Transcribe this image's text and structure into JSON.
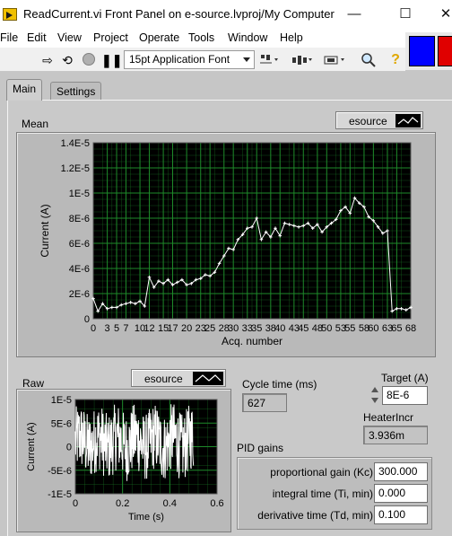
{
  "window": {
    "title": "ReadCurrent.vi Front Panel on e-source.lvproj/My Computer",
    "controls": {
      "minimize": "—",
      "maximize": "☐",
      "close": "✕"
    }
  },
  "menu": [
    "File",
    "Edit",
    "View",
    "Project",
    "Operate",
    "Tools",
    "Window",
    "Help"
  ],
  "toolbar": {
    "font": "15pt Application Font",
    "icons": [
      "run-arrow",
      "run-continuously",
      "abort",
      "pause",
      "align",
      "distribute",
      "resize",
      "search",
      "help"
    ]
  },
  "tabs": [
    "Main",
    "Settings"
  ],
  "mean_graph": {
    "label": "Mean",
    "legend": "esource",
    "colors": {
      "plot": "#ffffff",
      "background": "#000000",
      "grid": "#1e8a2a"
    }
  },
  "raw_graph": {
    "label": "Raw",
    "legend": "esource"
  },
  "chart_data": [
    {
      "type": "line",
      "name": "mean-graph",
      "title": "Mean",
      "xlabel": "Acq. number",
      "ylabel": "Current (A)",
      "xlim": [
        0,
        68
      ],
      "ylim": [
        0,
        1.4e-05
      ],
      "x_ticks": [
        0,
        3,
        5,
        7,
        10,
        12,
        15,
        17,
        20,
        23,
        25,
        28,
        30,
        33,
        35,
        38,
        40,
        43,
        45,
        48,
        50,
        53,
        55,
        58,
        60,
        63,
        65,
        68
      ],
      "y_ticks": [
        0,
        2e-06,
        4e-06,
        6e-06,
        8e-06,
        1e-05,
        1.2e-05,
        1.4e-05
      ],
      "y_tick_labels": [
        "0",
        "2E-6",
        "4E-6",
        "6E-6",
        "8E-6",
        "1E-5",
        "1.2E-5",
        "1.4E-5"
      ],
      "x_tick_labels": [
        "0",
        "3",
        "5",
        "7",
        "10",
        "12",
        "15",
        "17",
        "20",
        "23",
        "25",
        "28",
        "30",
        "33",
        "35",
        "38",
        "40",
        "43",
        "45",
        "48",
        "50",
        "53",
        "55",
        "58",
        "60",
        "63",
        "65",
        "68"
      ],
      "grid": true,
      "series": [
        {
          "name": "esource",
          "x": [
            0,
            1,
            2,
            3,
            4,
            5,
            6,
            7,
            8,
            9,
            10,
            11,
            12,
            13,
            14,
            15,
            16,
            17,
            18,
            19,
            20,
            21,
            22,
            23,
            24,
            25,
            26,
            27,
            28,
            29,
            30,
            31,
            32,
            33,
            34,
            35,
            36,
            37,
            38,
            39,
            40,
            41,
            42,
            43,
            44,
            45,
            46,
            47,
            48,
            49,
            50,
            51,
            52,
            53,
            54,
            55,
            56,
            57,
            58,
            59,
            60,
            61,
            62,
            63,
            64,
            65,
            66,
            67,
            68
          ],
          "y": [
            1.6e-06,
            6e-07,
            1.2e-06,
            8e-07,
            9e-07,
            9e-07,
            1.1e-06,
            1.2e-06,
            1.3e-06,
            1.2e-06,
            1.4e-06,
            1e-06,
            3.3e-06,
            2.5e-06,
            3e-06,
            2.8e-06,
            3.1e-06,
            2.7e-06,
            2.9e-06,
            3.1e-06,
            2.7e-06,
            2.8e-06,
            3.1e-06,
            3.2e-06,
            3.5e-06,
            3.4e-06,
            3.7e-06,
            4.4e-06,
            5e-06,
            5.6e-06,
            5.5e-06,
            6.3e-06,
            6.7e-06,
            7.2e-06,
            7.3e-06,
            8e-06,
            6.3e-06,
            6.9e-06,
            6.5e-06,
            7.2e-06,
            6.6e-06,
            7.6e-06,
            7.5e-06,
            7.4e-06,
            7.3e-06,
            7.4e-06,
            7.6e-06,
            7.2e-06,
            7.5e-06,
            6.9e-06,
            7.3e-06,
            7.6e-06,
            7.9e-06,
            8.6e-06,
            8.9e-06,
            8.4e-06,
            9.6e-06,
            9.2e-06,
            8.9e-06,
            8.1e-06,
            7.8e-06,
            7.3e-06,
            6.8e-06,
            7e-06,
            6e-07,
            8e-07,
            8e-07,
            7e-07,
            9e-07
          ]
        }
      ]
    },
    {
      "type": "line",
      "name": "raw-graph",
      "title": "Raw",
      "xlabel": "Time (s)",
      "ylabel": "Current (A)",
      "xlim": [
        0,
        0.6
      ],
      "ylim": [
        -1e-05,
        1e-05
      ],
      "x_ticks": [
        0,
        0.2,
        0.4,
        0.6
      ],
      "x_tick_labels": [
        "0",
        "0.2",
        "0.4",
        "0.6"
      ],
      "y_ticks": [
        -1e-05,
        -5e-06,
        0,
        5e-06,
        1e-05
      ],
      "y_tick_labels": [
        "-1E-5",
        "-5E-6",
        "0",
        "5E-6",
        "1E-5"
      ],
      "grid": true,
      "series": [
        {
          "name": "esource",
          "x_range": [
            0.0,
            0.5
          ],
          "y_range": [
            -8e-06,
            9e-06
          ],
          "y_mean": 1e-06
        }
      ]
    }
  ],
  "indicators": {
    "cycle_time": {
      "label": "Cycle time (ms)",
      "value": "627"
    },
    "target": {
      "label": "Target (A)",
      "value": "8E-6"
    },
    "heater_incr": {
      "label": "HeaterIncr",
      "value": "3.936m"
    }
  },
  "pid": {
    "label": "PID gains",
    "fields": [
      {
        "label": "proportional gain (Kc)",
        "value": "300.000"
      },
      {
        "label": "integral time (Ti, min)",
        "value": "0.000"
      },
      {
        "label": "derivative time (Td, min)",
        "value": "0.100"
      }
    ]
  }
}
